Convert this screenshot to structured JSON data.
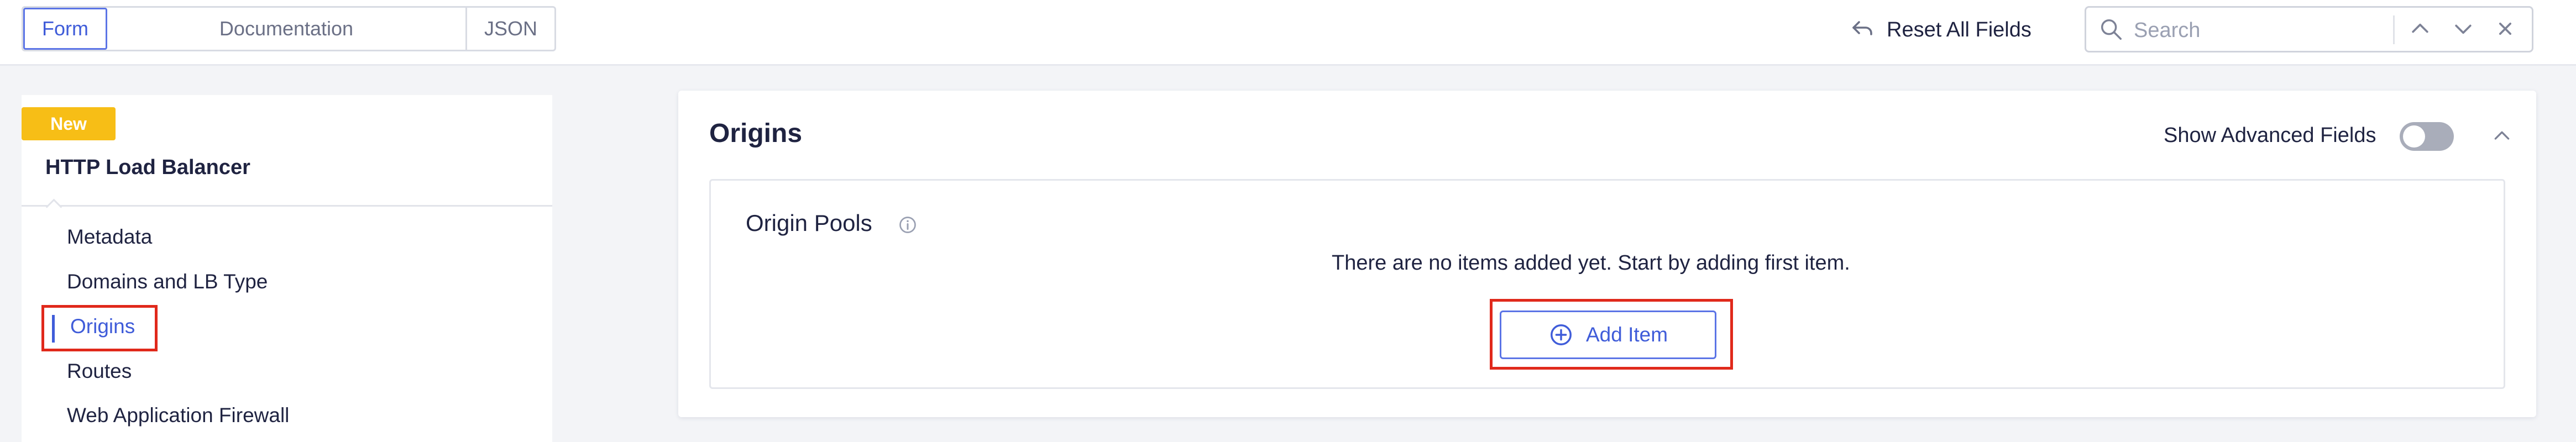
{
  "top_bar": {
    "view_tabs": [
      {
        "label": "Form",
        "active": true
      },
      {
        "label": "Documentation",
        "active": false
      },
      {
        "label": "JSON",
        "active": false
      }
    ],
    "reset_label": "Reset All Fields",
    "search": {
      "placeholder": "Search",
      "value": ""
    }
  },
  "left_nav": {
    "badge": "New",
    "title": "HTTP Load Balancer",
    "items": [
      {
        "label": "Metadata",
        "active": false
      },
      {
        "label": "Domains and LB Type",
        "active": false
      },
      {
        "label": "Origins",
        "active": true
      },
      {
        "label": "Routes",
        "active": false
      },
      {
        "label": "Web Application Firewall",
        "active": false
      }
    ]
  },
  "main": {
    "section_title": "Origins",
    "advanced_fields_label": "Show Advanced Fields",
    "advanced_fields_enabled": false,
    "origin_pools": {
      "title": "Origin Pools",
      "empty_message": "There are no items added yet. Start by adding first item.",
      "add_label": "Add Item"
    }
  },
  "colors": {
    "accent": "#3f5cd9",
    "badge": "#f7be16",
    "highlight": "#e0291b",
    "text": "#1f2341"
  }
}
